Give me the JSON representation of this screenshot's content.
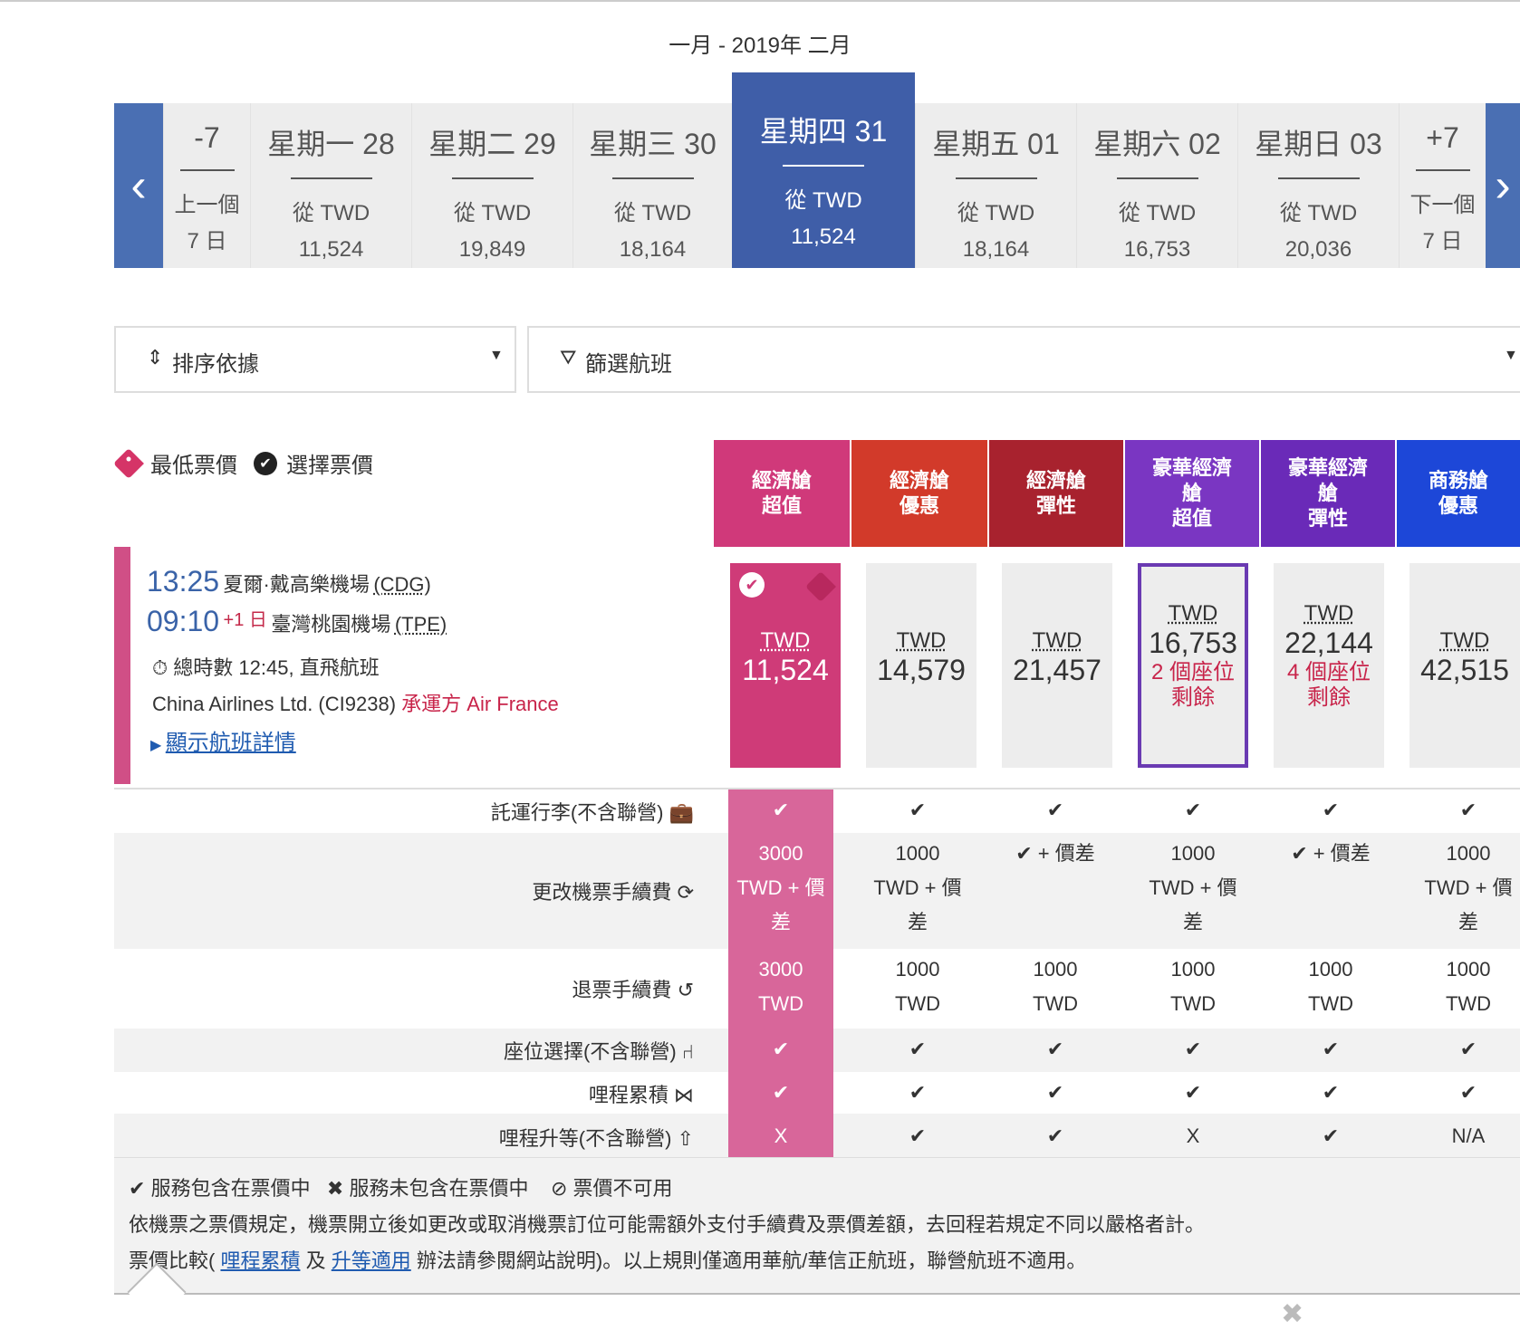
{
  "month_header": "一月 - 2019年 二月",
  "dates": {
    "prev": {
      "top": "-7",
      "line1": "上一個",
      "line2": "7 日"
    },
    "next": {
      "top": "+7",
      "line1": "下一個",
      "line2": "7 日"
    },
    "days": [
      {
        "day": "星期一 28",
        "from": "從 TWD",
        "price": "11,524"
      },
      {
        "day": "星期二 29",
        "from": "從 TWD",
        "price": "19,849"
      },
      {
        "day": "星期三 30",
        "from": "從 TWD",
        "price": "18,164"
      },
      {
        "day": "星期四 31",
        "from": "從 TWD",
        "price": "11,524"
      },
      {
        "day": "星期五 01",
        "from": "從 TWD",
        "price": "18,164"
      },
      {
        "day": "星期六 02",
        "from": "從 TWD",
        "price": "16,753"
      },
      {
        "day": "星期日 03",
        "from": "從 TWD",
        "price": "20,036"
      }
    ]
  },
  "sort_label": "排序依據",
  "filter_label": "篩選航班",
  "legend": {
    "lowest": "最低票價",
    "selected": "選擇票價"
  },
  "fare_columns": [
    {
      "line1": "經濟艙",
      "line2": "超值",
      "line3": "",
      "color": "#d0397a"
    },
    {
      "line1": "經濟艙",
      "line2": "優惠",
      "line3": "",
      "color": "#d23a2a"
    },
    {
      "line1": "經濟艙",
      "line2": "彈性",
      "line3": "",
      "color": "#a8222e"
    },
    {
      "line1": "豪華經濟",
      "line2": "艙",
      "line3": "超值",
      "color": "#7a36c2"
    },
    {
      "line1": "豪華經濟",
      "line2": "艙",
      "line3": "彈性",
      "color": "#6a2ab8"
    },
    {
      "line1": "商務艙",
      "line2": "優惠",
      "line3": "",
      "color": "#1d47d8"
    }
  ],
  "flight": {
    "dep_time": "13:25",
    "dep_airport": "夏爾·戴高樂機場",
    "dep_code": "(CDG)",
    "arr_time": "09:10",
    "arr_plus": "+1 日",
    "arr_airport": "臺灣桃園機場",
    "arr_code": "(TPE)",
    "duration": "總時數 12:45, 直飛航班",
    "carrier": "China Airlines Ltd. (CI9238)",
    "operated": "承運方 Air France",
    "details_link": "顯示航班詳情"
  },
  "prices": [
    {
      "currency": "TWD",
      "amount": "11,524",
      "seats1": "",
      "seats2": ""
    },
    {
      "currency": "TWD",
      "amount": "14,579",
      "seats1": "",
      "seats2": ""
    },
    {
      "currency": "TWD",
      "amount": "21,457",
      "seats1": "",
      "seats2": ""
    },
    {
      "currency": "TWD",
      "amount": "16,753",
      "seats1": "2 個座位",
      "seats2": "剩餘"
    },
    {
      "currency": "TWD",
      "amount": "22,144",
      "seats1": "4 個座位",
      "seats2": "剩餘"
    },
    {
      "currency": "TWD",
      "amount": "42,515",
      "seats1": "",
      "seats2": ""
    }
  ],
  "features": [
    {
      "label": "託運行李(不含聯營)",
      "icon": "suitcase-icon",
      "glyph": "💼",
      "values": [
        "✔",
        "✔",
        "✔",
        "✔",
        "✔",
        "✔"
      ]
    },
    {
      "label": "更改機票手續費",
      "icon": "refresh-icon",
      "glyph": "⟳",
      "values": [
        "3000\nTWD + 價\n差",
        "1000\nTWD + 價\n差",
        "✔ + 價差",
        "1000\nTWD + 價\n差",
        "✔ + 價差",
        "1000\nTWD + 價\n差"
      ]
    },
    {
      "label": "退票手續費",
      "icon": "refund-icon",
      "glyph": "↺",
      "values": [
        "3000\nTWD",
        "1000\nTWD",
        "1000\nTWD",
        "1000\nTWD",
        "1000\nTWD",
        "1000\nTWD"
      ]
    },
    {
      "label": "座位選擇(不含聯營)",
      "icon": "seat-icon",
      "glyph": "⑁",
      "values": [
        "✔",
        "✔",
        "✔",
        "✔",
        "✔",
        "✔"
      ]
    },
    {
      "label": "哩程累積",
      "icon": "miles-icon",
      "glyph": "⋈",
      "values": [
        "✔",
        "✔",
        "✔",
        "✔",
        "✔",
        "✔"
      ]
    },
    {
      "label": "哩程升等(不含聯營)",
      "icon": "upgrade-icon",
      "glyph": "⇧",
      "values": [
        "X",
        "✔",
        "✔",
        "X",
        "✔",
        "N/A"
      ]
    }
  ],
  "footer": {
    "legend_included": "服務包含在票價中",
    "legend_excluded": "服務未包含在票價中",
    "legend_unavailable": "票價不可用",
    "note1": "依機票之票價規定，機票開立後如更改或取消機票訂位可能需額外支付手續費及票價差額，去回程若規定不同以嚴格者計。",
    "note2_prefix": "票價比較(",
    "link_miles": "哩程累積",
    "note2_and": "及",
    "link_upgrade": "升等適用",
    "note2_suffix": "辦法請參閱網站說明)。以上規則僅適用華航/華信正航班，聯營航班不適用。"
  }
}
